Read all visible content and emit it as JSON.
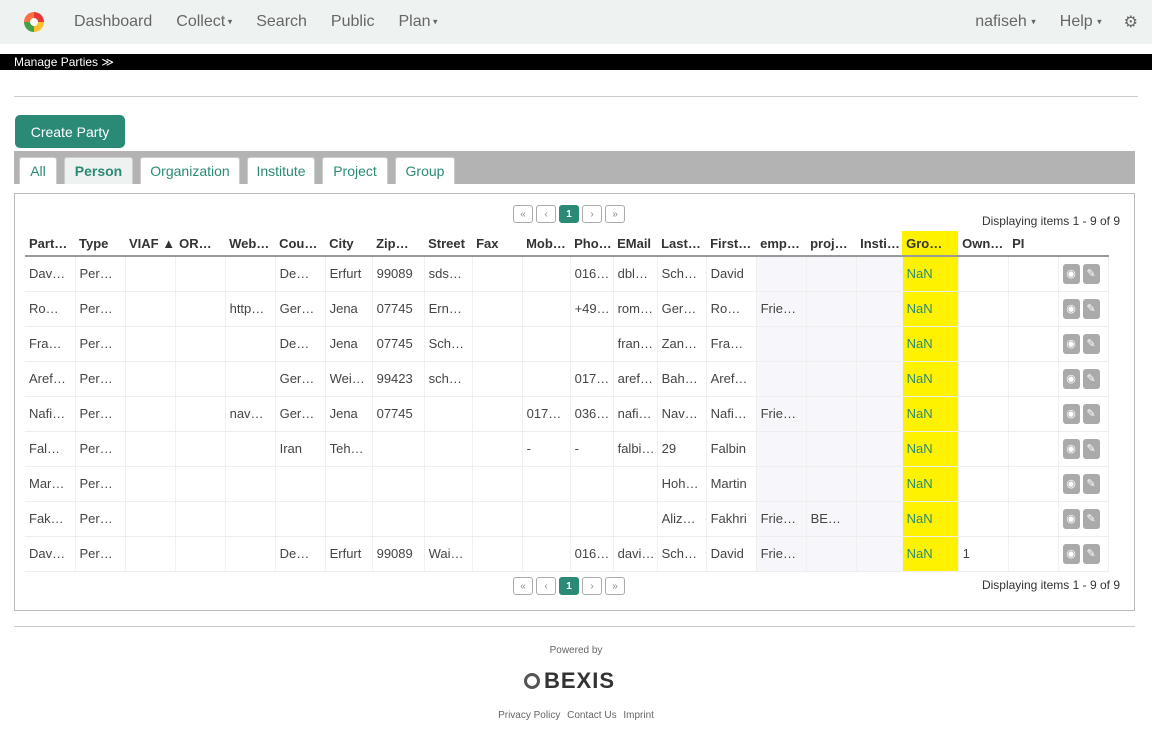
{
  "nav": {
    "items": [
      {
        "label": "Dashboard",
        "caret": false
      },
      {
        "label": "Collect",
        "caret": true
      },
      {
        "label": "Search",
        "caret": false
      },
      {
        "label": "Public",
        "caret": false
      },
      {
        "label": "Plan",
        "caret": true
      }
    ],
    "user": "nafiseh",
    "help": "Help"
  },
  "menubar": {
    "label": "Manage Parties ≫"
  },
  "create_button": "Create Party",
  "tabs": [
    "All",
    "Person",
    "Organization",
    "Institute",
    "Project",
    "Group"
  ],
  "active_tab": "Person",
  "pager": {
    "first": "«",
    "prev": "‹",
    "page": "1",
    "next": "›",
    "last": "»"
  },
  "display_text": "Displaying items 1 - 9 of 9",
  "columns": [
    "Part…",
    "Type",
    "VIAF ▲",
    "OR…",
    "Web…",
    "Cou…",
    "City",
    "Zip…",
    "Street",
    "Fax",
    "Mob…",
    "Pho…",
    "EMail",
    "Last…",
    "First…",
    "emp…",
    "proj…",
    "Insti…",
    "Gro…",
    "Own…",
    "PI",
    ""
  ],
  "rows": [
    [
      "Dav…",
      "Per…",
      "",
      "",
      "",
      "De…",
      "Erfurt",
      "99089",
      "sds…",
      "",
      "",
      "016…",
      "dbl…",
      "Sch…",
      "David",
      "",
      "",
      "",
      "NaN",
      "",
      ""
    ],
    [
      "Ro…",
      "Per…",
      "",
      "",
      "http…",
      "Ger…",
      "Jena",
      "07745",
      "Ern…",
      "",
      "",
      "+49…",
      "rom…",
      "Ger…",
      "Ro…",
      "Frie…",
      "",
      "",
      "NaN",
      "",
      ""
    ],
    [
      "Fra…",
      "Per…",
      "",
      "",
      "",
      "De…",
      "Jena",
      "07745",
      "Sch…",
      "",
      "",
      "",
      "fran…",
      "Zan…",
      "Fra…",
      "",
      "",
      "",
      "NaN",
      "",
      ""
    ],
    [
      "Aref…",
      "Per…",
      "",
      "",
      "",
      "Ger…",
      "Wei…",
      "99423",
      "sch…",
      "",
      "",
      "017…",
      "aref…",
      "Bah…",
      "Aref…",
      "",
      "",
      "",
      "NaN",
      "",
      ""
    ],
    [
      "Nafi…",
      "Per…",
      "",
      "",
      "nav…",
      "Ger…",
      "Jena",
      "07745",
      "",
      "",
      "017…",
      "036…",
      "nafi…",
      "Nav…",
      "Nafi…",
      "Frie…",
      "",
      "",
      "NaN",
      "",
      ""
    ],
    [
      "Fal…",
      "Per…",
      "",
      "",
      "",
      "Iran",
      "Teh…",
      "",
      "",
      "",
      "-",
      "-",
      "falbi…",
      "29",
      "Falbin",
      "",
      "",
      "",
      "NaN",
      "",
      ""
    ],
    [
      "Mar…",
      "Per…",
      "",
      "",
      "",
      "",
      "",
      "",
      "",
      "",
      "",
      "",
      "",
      "Hoh…",
      "Martin",
      "",
      "",
      "",
      "NaN",
      "",
      ""
    ],
    [
      "Fak…",
      "Per…",
      "",
      "",
      "",
      "",
      "",
      "",
      "",
      "",
      "",
      "",
      "",
      "Aliz…",
      "Fakhri",
      "Frie…",
      "BE…",
      "",
      "NaN",
      "",
      ""
    ],
    [
      "Dav…",
      "Per…",
      "",
      "",
      "",
      "De…",
      "Erfurt",
      "99089",
      "Wai…",
      "",
      "",
      "016…",
      "davi…",
      "Sch…",
      "David",
      "Frie…",
      "",
      "",
      "NaN",
      "1",
      ""
    ]
  ],
  "footer": {
    "powered_by": "Powered by",
    "brand": "BEXIS",
    "links": [
      "Privacy Policy",
      "Contact Us",
      "Imprint"
    ]
  },
  "colors": {
    "accent": "#2a8a76",
    "highlight": "#fff200"
  }
}
